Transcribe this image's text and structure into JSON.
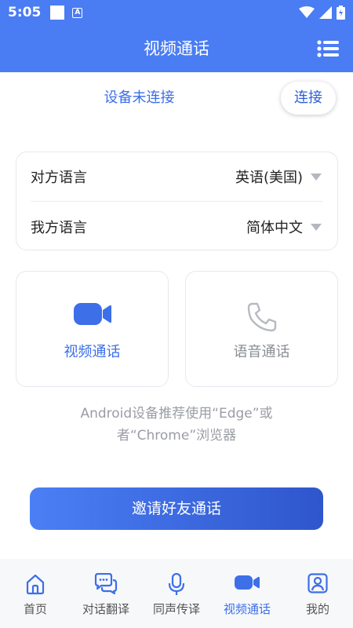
{
  "status_bar": {
    "time": "5:05",
    "icons": [
      "square-notification-icon",
      "font-a-icon",
      "wifi-icon",
      "signal-icon",
      "battery-icon"
    ]
  },
  "header": {
    "title": "视频通话",
    "menu_icon": "menu-list-icon"
  },
  "connection": {
    "status": "设备未连接",
    "button": "连接"
  },
  "languages": {
    "peer_label": "对方语言",
    "peer_value": "英语(美国)",
    "mine_label": "我方语言",
    "mine_value": "简体中文"
  },
  "call_options": {
    "video_label": "视频通话",
    "video_icon": "video-camera-icon",
    "voice_label": "语音通话",
    "voice_icon": "phone-icon"
  },
  "hint": {
    "line1": "Android设备推荐使用“Edge”或",
    "line2": "者“Chrome”浏览器"
  },
  "invite_button": "邀请好友通话",
  "bottom_nav": {
    "items": [
      {
        "label": "首页",
        "icon": "home-icon"
      },
      {
        "label": "对话翻译",
        "icon": "chat-bubbles-icon"
      },
      {
        "label": "同声传译",
        "icon": "microphone-icon"
      },
      {
        "label": "视频通话",
        "icon": "video-camera-icon"
      },
      {
        "label": "我的",
        "icon": "profile-icon"
      }
    ],
    "active_index": 3
  },
  "colors": {
    "primary": "#4a7cf3",
    "accent_text": "#3c6fe8",
    "muted": "#9a9da4"
  }
}
